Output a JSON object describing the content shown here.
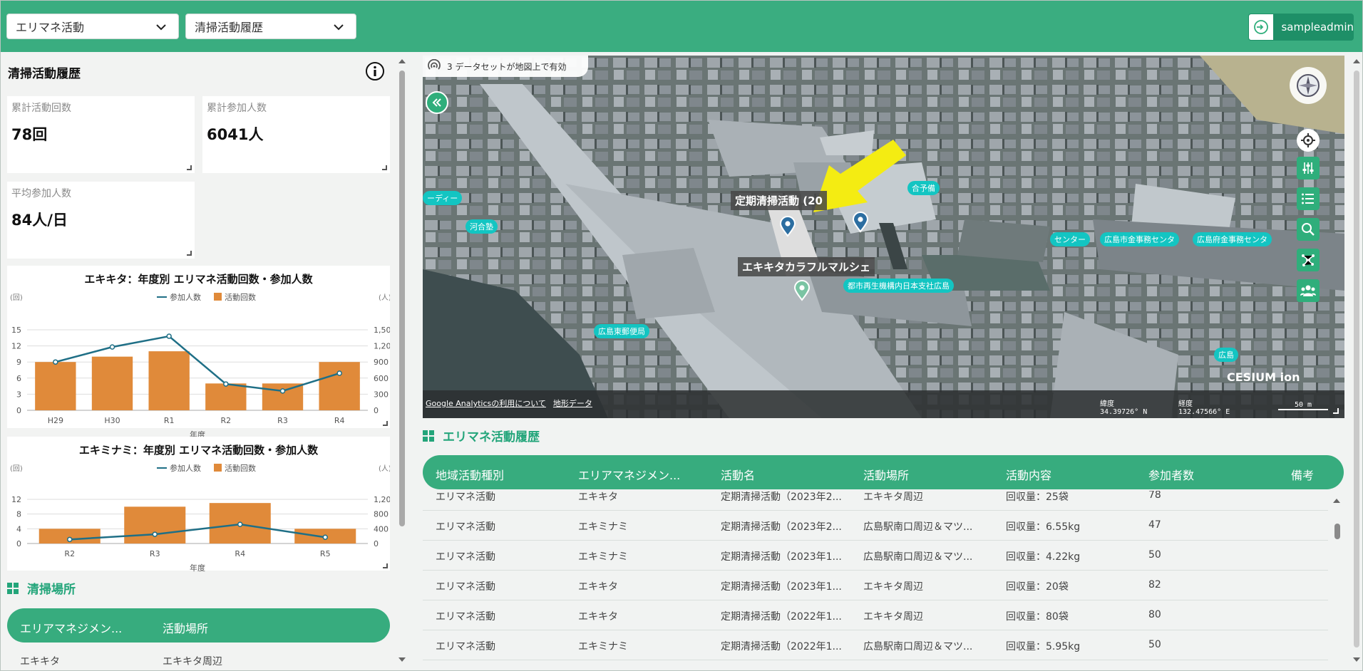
{
  "header": {
    "dropdown1": "エリマネ活動",
    "dropdown2": "清掃活動履歴",
    "username": "sampleadmin"
  },
  "left": {
    "title": "清掃活動履歴",
    "cards": [
      {
        "label": "累計活動回数",
        "value": "78回"
      },
      {
        "label": "累計参加人数",
        "value": "6041人"
      },
      {
        "label": "平均参加人数",
        "value": "84人/日"
      }
    ],
    "places_title": "清掃場所",
    "places_headers": [
      "エリアマネジメン...",
      "活動場所"
    ],
    "places_rows": [
      [
        "エキキタ",
        "エキキタ周辺"
      ]
    ]
  },
  "chart_data": [
    {
      "type": "bar",
      "title": "エキキタ：年度別 エリマネ活動回数・参加人数",
      "xlabel": "年度",
      "ylabel_left": "(回)",
      "ylabel_right": "(人)",
      "categories": [
        "H29",
        "H30",
        "R1",
        "R2",
        "R3",
        "R4"
      ],
      "ylim_left": [
        0,
        15
      ],
      "ylim_right": [
        0,
        1500
      ],
      "yticks_left": [
        "0",
        "3",
        "6",
        "9",
        "12",
        "15"
      ],
      "yticks_right": [
        "0",
        "300",
        "600",
        "900",
        "1,200",
        "1,50"
      ],
      "series": [
        {
          "name": "参加人数",
          "kind": "line",
          "axis": "right",
          "values": [
            900,
            1180,
            1380,
            490,
            360,
            690
          ]
        },
        {
          "name": "活動回数",
          "kind": "bar",
          "axis": "left",
          "values": [
            9,
            10,
            11,
            5,
            5,
            9
          ]
        }
      ],
      "colors": {
        "bar": "#e08a3a",
        "line": "#1f6f86"
      }
    },
    {
      "type": "bar",
      "title": "エキミナミ：年度別 エリマネ活動回数・参加人数",
      "xlabel": "年度",
      "ylabel_left": "(回)",
      "ylabel_right": "(人)",
      "categories": [
        "R2",
        "R3",
        "R4",
        "R5"
      ],
      "ylim_left": [
        0,
        12
      ],
      "ylim_right": [
        0,
        1200
      ],
      "yticks_left": [
        "0",
        "4",
        "8",
        "12"
      ],
      "yticks_right": [
        "0",
        "400",
        "800",
        "1,20"
      ],
      "series": [
        {
          "name": "参加人数",
          "kind": "line",
          "axis": "right",
          "values": [
            110,
            250,
            520,
            170
          ]
        },
        {
          "name": "活動回数",
          "kind": "bar",
          "axis": "left",
          "values": [
            4,
            10,
            11,
            4
          ]
        }
      ],
      "colors": {
        "bar": "#e08a3a",
        "line": "#1f6f86"
      }
    }
  ],
  "map": {
    "dataset_notice": "3 データセットが地図上で有効",
    "marker1": "定期清掃活動 (20",
    "marker2": "エキキタカラフルマルシェ",
    "tags": [
      "ーディー",
      "河合塾",
      "合予備",
      "センター",
      "広島市金事務センタ",
      "広島府金事務センタ",
      "都市再生機構内日本支社広島",
      "広島東郵便局",
      "広島"
    ],
    "footer_link1": "Google Analyticsの利用について",
    "footer_link2": "地形データ",
    "lat_label": "緯度",
    "lat_value": "34.39726° N",
    "lon_label": "経度",
    "lon_value": "132.47566° E",
    "scale": "50 m",
    "brand": "CESIUM ion"
  },
  "history": {
    "title": "エリマネ活動履歴",
    "headers": [
      "地域活動種別",
      "エリアマネジメン...",
      "活動名",
      "活動場所",
      "活動内容",
      "参加者数",
      "備考"
    ],
    "rows": [
      [
        "エリマネ活動",
        "エキキタ",
        "定期清掃活動（2023年2...",
        "エキキタ周辺",
        "回収量：25袋",
        "78",
        ""
      ],
      [
        "エリマネ活動",
        "エキミナミ",
        "定期清掃活動（2023年2...",
        "広島駅南口周辺＆マツ...",
        "回収量：6.55kg",
        "47",
        ""
      ],
      [
        "エリマネ活動",
        "エキミナミ",
        "定期清掃活動（2023年1...",
        "広島駅南口周辺＆マツ...",
        "回収量：4.22kg",
        "50",
        ""
      ],
      [
        "エリマネ活動",
        "エキキタ",
        "定期清掃活動（2023年1...",
        "エキキタ周辺",
        "回収量：20袋",
        "82",
        ""
      ],
      [
        "エリマネ活動",
        "エキキタ",
        "定期清掃活動（2022年1...",
        "エキキタ周辺",
        "回収量：80袋",
        "80",
        ""
      ],
      [
        "エリマネ活動",
        "エキミナミ",
        "定期清掃活動（2022年1...",
        "広島駅南口周辺＆マツ...",
        "回収量：5.95kg",
        "50",
        ""
      ]
    ]
  }
}
